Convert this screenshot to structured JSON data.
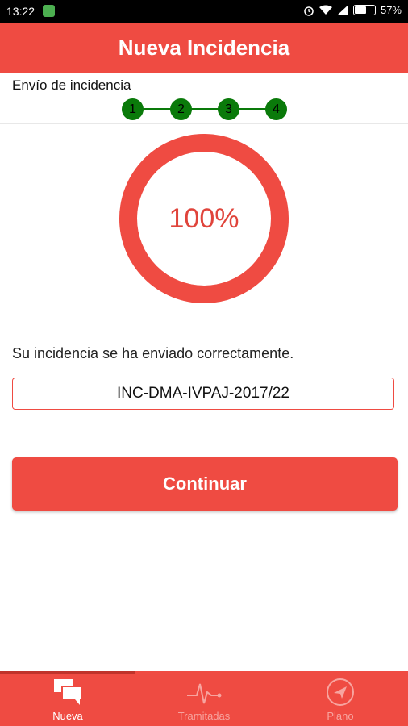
{
  "status_bar": {
    "time": "13:22",
    "battery": "57%"
  },
  "app_bar": {
    "title": "Nueva Incidencia"
  },
  "stepper": {
    "title": "Envío de incidencia",
    "steps": [
      "1",
      "2",
      "3",
      "4"
    ],
    "step_color": "#0a7a0a"
  },
  "progress": {
    "value": 1.0,
    "label": "100%"
  },
  "result": {
    "message": "Su incidencia se ha enviado correctamente.",
    "reference": "INC-DMA-IVPAJ-2017/22"
  },
  "actions": {
    "continue_label": "Continuar"
  },
  "bottom_nav": {
    "items": [
      {
        "label": "Nueva",
        "icon": "chat-bubbles-icon",
        "active": true
      },
      {
        "label": "Tramitadas",
        "icon": "pulse-icon",
        "active": false
      },
      {
        "label": "Plano",
        "icon": "navigation-compass-icon",
        "active": false
      }
    ]
  },
  "colors": {
    "accent": "#ef4b42",
    "text": "#222222"
  }
}
